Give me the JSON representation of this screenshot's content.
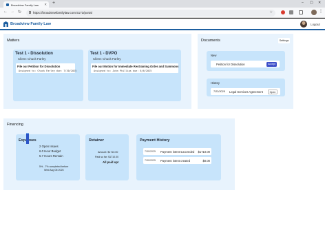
{
  "browser": {
    "tab_title": "Broadview Family Law",
    "url": "https://broadviewfamilylaw.com:5173/portal"
  },
  "app": {
    "brand": "Broadview Family Law",
    "logout_label": "Logout"
  },
  "matters": {
    "heading": "Matters",
    "cards": [
      {
        "title": "Test 1 - Dissolution",
        "client": "Client: Chuck Farley",
        "task_title": "File our Petition for Dissolution",
        "task_meta": "Assigned to: Chuck Farley  due: 7/30/2025"
      },
      {
        "title": "Test 1 - DVPO",
        "client": "Client: Chuck Farley",
        "task_title": "File our Motion for Immediate Restraining Order and Summons",
        "task_meta": "Assigned to: John Phillips  due: 8/6/2025"
      }
    ]
  },
  "documents": {
    "heading": "Documents",
    "settings_label": "Settings",
    "new_label": "New",
    "new_item": "Petition for Dissolution",
    "accept_label": "Accept",
    "history_label": "History",
    "history_date": "7/23/2025",
    "history_item": "Legal Services Agreement",
    "open_label": "Open"
  },
  "financing": {
    "heading": "Financing",
    "expenses": {
      "title": "Expenses",
      "open_issues": "2 Open Issues",
      "budget": "6.0 Hour Budget",
      "remain": "5.7 Hours Remain",
      "completed_line1": "5% - 7% completed before",
      "completed_line2": "Wed Aug 06 2025",
      "progress_fraction": 0.05
    },
    "retainer": {
      "title": "Retainer",
      "amount": "Amount: $1710.00",
      "paid": "Paid so far: $1710.00",
      "status": "All paid up!"
    },
    "payment_history": {
      "title": "Payment History",
      "rows": [
        {
          "date": "7/30/2025",
          "desc": "Payment intent succeeded",
          "amount": "$1710.00"
        },
        {
          "date": "7/30/2025",
          "desc": "Payment intent created",
          "amount": "$0.00"
        }
      ]
    }
  },
  "colors": {
    "brand": "#1d5fa0",
    "panel": "#e8f3fd",
    "card": "#c7e4fb",
    "accept": "#3d4fc9"
  }
}
